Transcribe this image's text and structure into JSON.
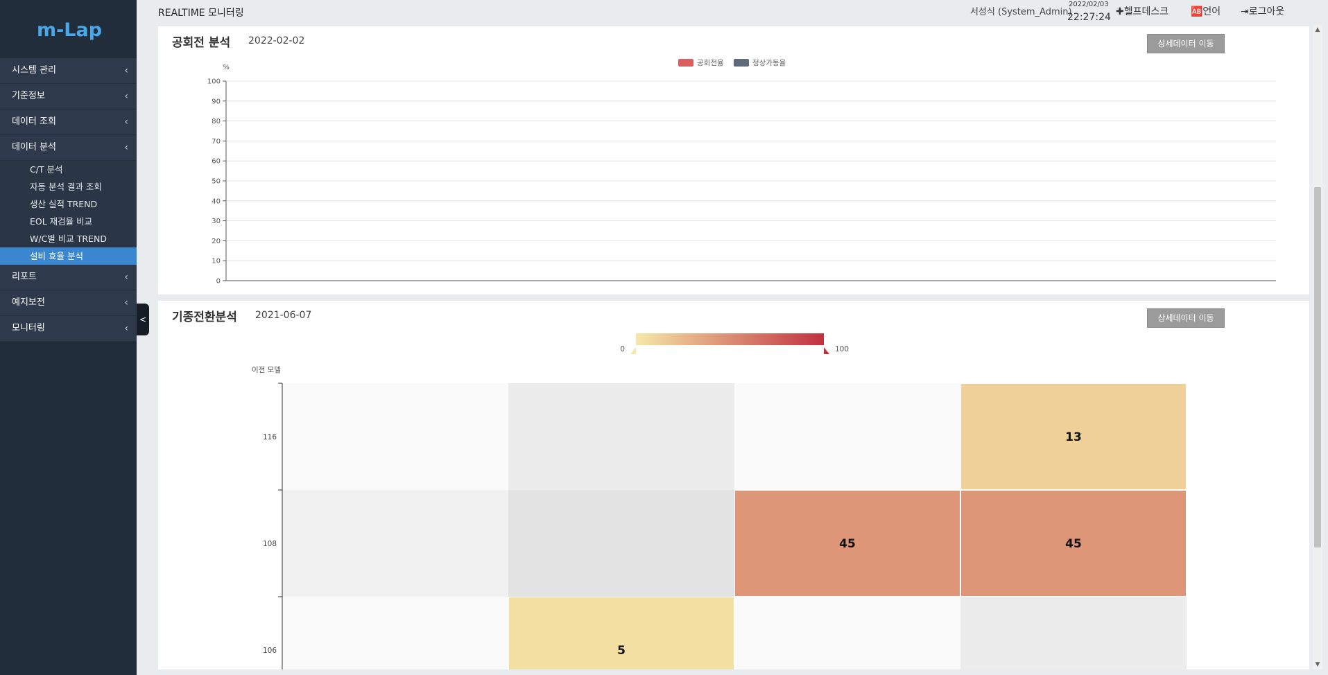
{
  "app": {
    "logo": "m-Lap",
    "collapse_glyph": "<"
  },
  "sidebar": {
    "items": [
      {
        "label": "시스템 관리",
        "icon": "chevron-left-icon"
      },
      {
        "label": "기준정보",
        "icon": "chevron-left-icon"
      },
      {
        "label": "데이터 조회",
        "icon": "chevron-left-icon"
      },
      {
        "label": "데이터 분석",
        "icon": "chevron-down-icon"
      },
      {
        "label": "리포트",
        "icon": "chevron-left-icon"
      },
      {
        "label": "예지보전",
        "icon": "chevron-left-icon"
      },
      {
        "label": "모니터링",
        "icon": "chevron-left-icon"
      }
    ],
    "subitems": [
      "C/T 분석",
      "자동 분석 결과 조회",
      "생산 실적 TREND",
      "EOL 재검율 비교",
      "W/C별 비교 TREND",
      "설비 효율 분석"
    ],
    "active_subitem": "설비 효율 분석",
    "chevron_glyph": "‹"
  },
  "topbar": {
    "title": "REALTIME 모니터링",
    "user": "서성식 (System_Admin)",
    "date": "2022/02/03",
    "time": "22:27:24",
    "helpdesk": "✚헬프데스크",
    "language": "🆎언어",
    "logout": "⇥로그아웃"
  },
  "panel1": {
    "title": "공회전 분석",
    "date": "2022-02-02",
    "button": "상세데이터 이동"
  },
  "panel2": {
    "title": "기종전환분석",
    "date": "2021-06-07",
    "button": "상세데이터 이동"
  },
  "colors": {
    "sidebar_bg": "#222d3b",
    "menu_bg": "#2e3a4b",
    "active": "#3a87cf",
    "series_red": "#d9605f",
    "series_gray": "#5f6b7a",
    "scale_low": "#f6e8a7",
    "scale_high": "#c0313f"
  },
  "chart_data": [
    {
      "type": "line",
      "ylabel": "%",
      "ylim": [
        0,
        100
      ],
      "yticks": [
        0,
        10,
        20,
        30,
        40,
        50,
        60,
        70,
        80,
        90,
        100
      ],
      "series": [
        {
          "name": "공회전율",
          "values": []
        },
        {
          "name": "정상가동율",
          "values": []
        }
      ],
      "grid": true,
      "legend": "top-center"
    },
    {
      "type": "heatmap",
      "ylabel": "이전 모델",
      "ycategories": [
        "116",
        "108",
        "106"
      ],
      "scale_min": 0,
      "scale_max": 100,
      "cells": [
        {
          "row": 0,
          "col": 3,
          "value": 13
        },
        {
          "row": 1,
          "col": 2,
          "value": 45
        },
        {
          "row": 1,
          "col": 3,
          "value": 45
        },
        {
          "row": 2,
          "col": 1,
          "value": 5
        }
      ]
    }
  ]
}
